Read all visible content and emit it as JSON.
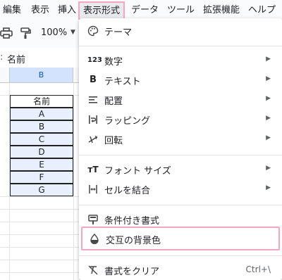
{
  "menubar": {
    "items": [
      "編集",
      "表示",
      "挿入",
      "表示形式",
      "データ",
      "ツール",
      "拡張機能",
      "ヘルプ"
    ]
  },
  "toolbar": {
    "zoom": "100%"
  },
  "formula_bar": {
    "value": "名前"
  },
  "sheet": {
    "column_header": "B",
    "cells": [
      "名前",
      "A",
      "B",
      "C",
      "D",
      "E",
      "F",
      "G"
    ]
  },
  "format_menu": {
    "theme": {
      "label": "テーマ",
      "icon": "palette-icon"
    },
    "number": {
      "label": "数字",
      "icon": "number-format-icon"
    },
    "text": {
      "label": "テキスト",
      "icon": "bold-icon"
    },
    "align": {
      "label": "配置",
      "icon": "align-icon"
    },
    "wrap": {
      "label": "ラッピング",
      "icon": "text-wrap-icon"
    },
    "rotate": {
      "label": "回転",
      "icon": "text-rotation-icon"
    },
    "font_size": {
      "label": "フォント サイズ",
      "icon": "font-size-icon"
    },
    "merge": {
      "label": "セルを結合",
      "icon": "merge-cells-icon"
    },
    "conditional": {
      "label": "条件付き書式",
      "icon": "conditional-format-icon"
    },
    "alternating": {
      "label": "交互の背景色",
      "icon": "fill-drop-icon"
    },
    "clear": {
      "label": "書式をクリア",
      "icon": "clear-format-icon",
      "shortcut": "Ctrl+\\"
    }
  },
  "colors": {
    "highlight": "#f4a6c0",
    "selected_header": "#d3e3fd",
    "selected_cell": "#e8f0fe"
  }
}
